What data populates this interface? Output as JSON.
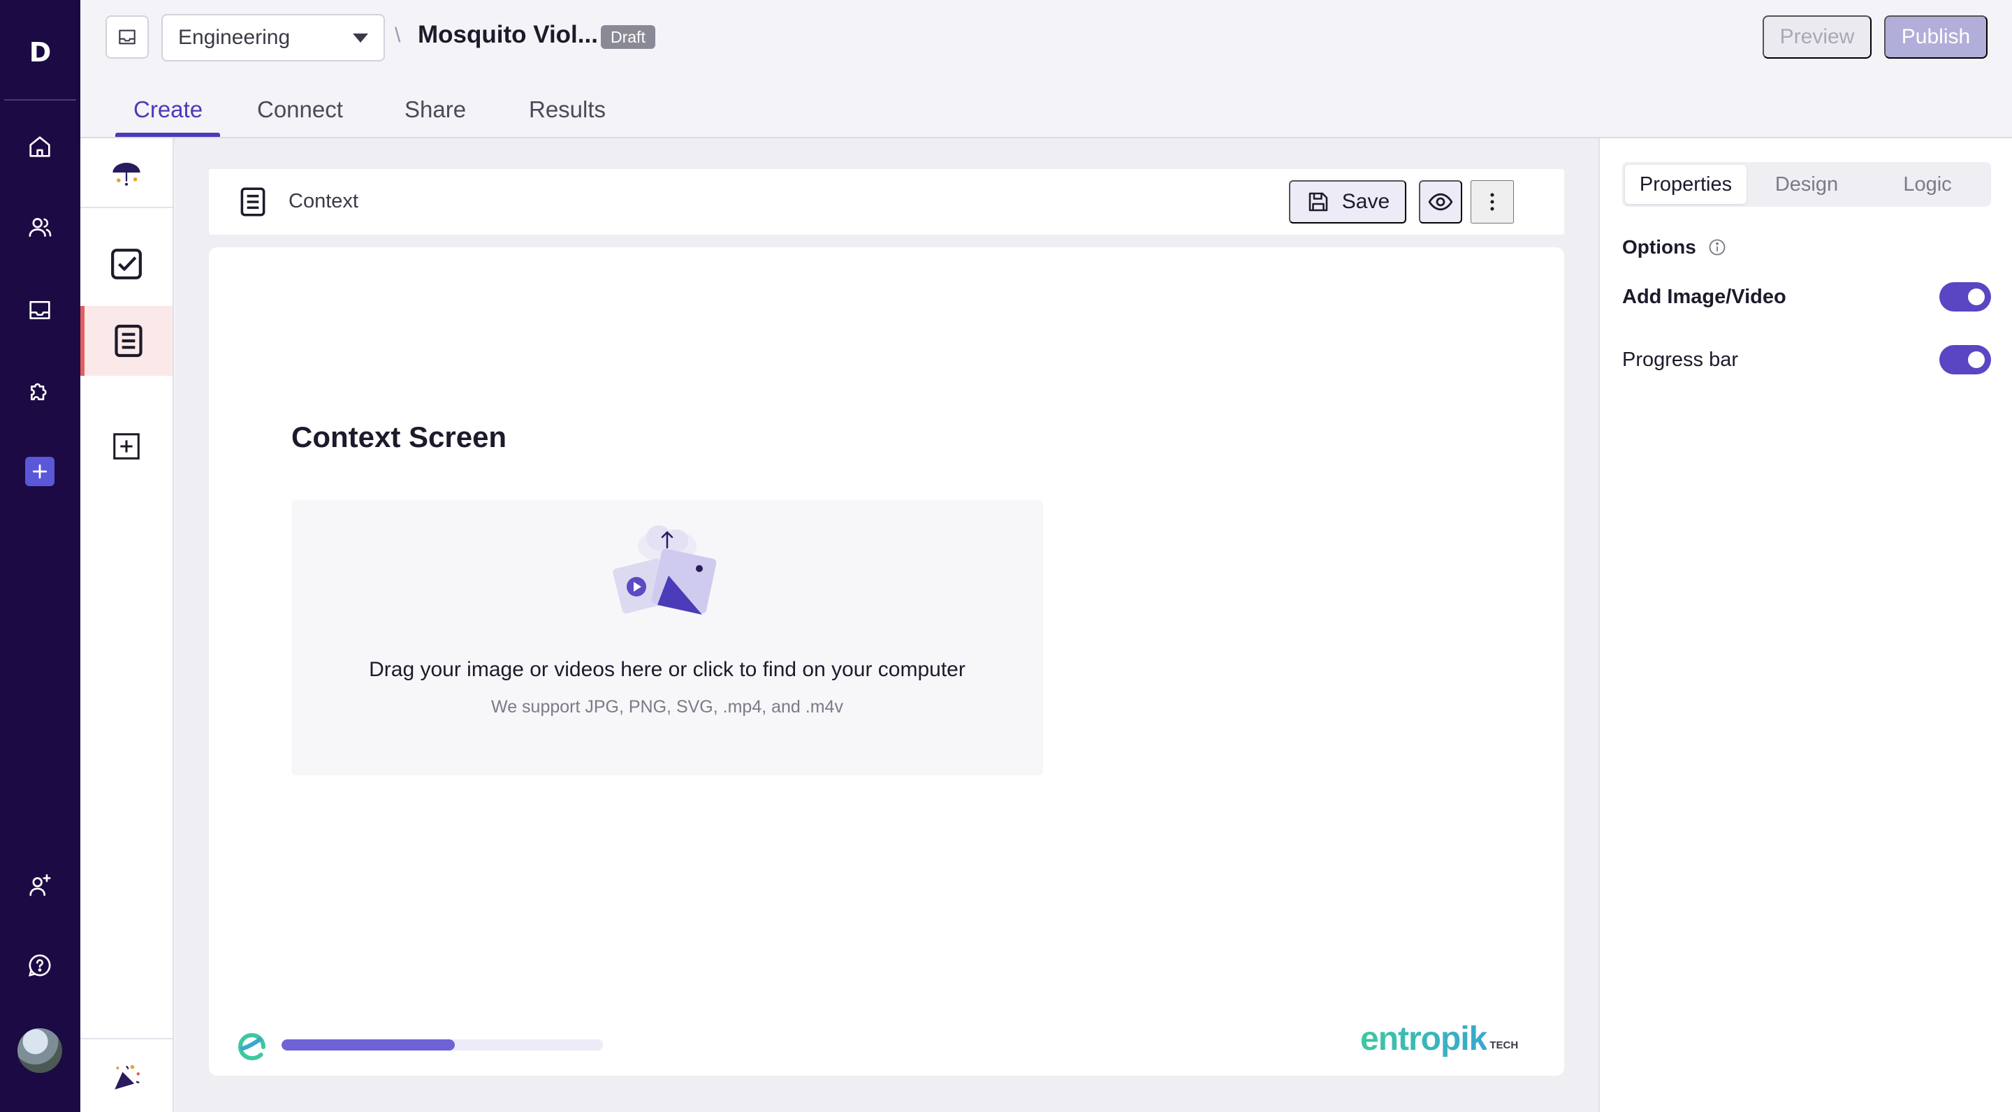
{
  "app": {
    "logo_letter": "D"
  },
  "rail": {
    "items": [
      {
        "name": "home",
        "icon": "home-icon"
      },
      {
        "name": "users",
        "icon": "users-icon"
      },
      {
        "name": "inbox",
        "icon": "inbox-icon"
      },
      {
        "name": "integrations",
        "icon": "puzzle-icon"
      },
      {
        "name": "create-new",
        "icon": "plus-icon"
      }
    ],
    "bottom": [
      {
        "name": "invite-user",
        "icon": "user-plus-icon"
      },
      {
        "name": "help",
        "icon": "help-icon"
      },
      {
        "name": "profile",
        "icon": "avatar"
      }
    ]
  },
  "header": {
    "workspace": "Engineering",
    "separator": "\\",
    "study_title": "Mosquito Viol...",
    "status_badge": "Draft",
    "preview_label": "Preview",
    "publish_label": "Publish",
    "tabs": [
      {
        "label": "Create",
        "active": true
      },
      {
        "label": "Connect",
        "active": false
      },
      {
        "label": "Share",
        "active": false
      },
      {
        "label": "Results",
        "active": false
      }
    ]
  },
  "toolbar": {
    "block_label": "Context",
    "save_label": "Save"
  },
  "canvas": {
    "screen_title": "Context Screen",
    "dropzone_main": "Drag your image or videos here or click to find on your computer",
    "dropzone_sub": "We support JPG, PNG, SVG, .mp4, and .m4v",
    "progress_fraction": 0.54,
    "brand_word": "entropik",
    "brand_suffix": "TECH"
  },
  "panel": {
    "tabs": [
      {
        "label": "Properties",
        "active": true
      },
      {
        "label": "Design",
        "active": false
      },
      {
        "label": "Logic",
        "active": false
      }
    ],
    "options_title": "Options",
    "options": [
      {
        "label": "Add Image/Video",
        "enabled": true
      },
      {
        "label": "Progress bar",
        "enabled": true
      }
    ]
  },
  "colors": {
    "rail_bg": "#1c0a44",
    "accent": "#4a3bb8",
    "toggle_on": "#5a45c2",
    "progress": "#6f62d6",
    "active_screen_bar": "#e06060"
  }
}
